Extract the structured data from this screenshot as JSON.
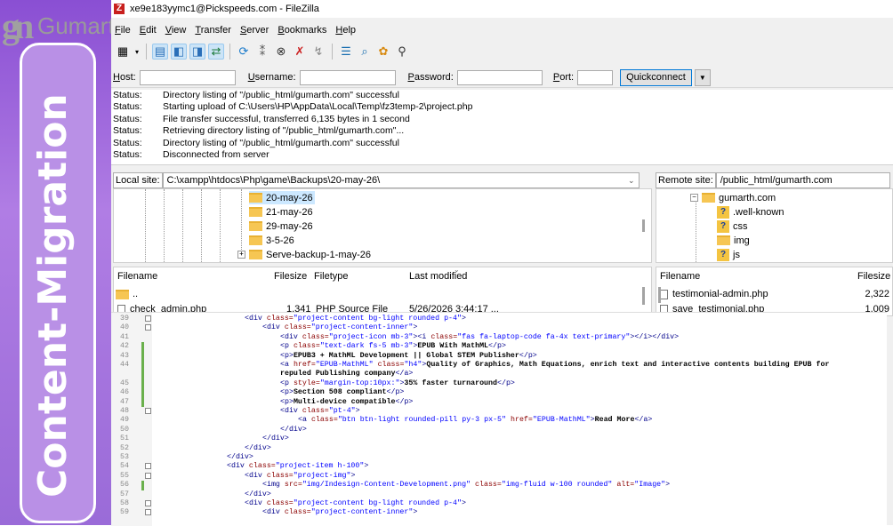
{
  "banner": {
    "logo_mark": "gn",
    "logo_text": "Gumarth",
    "vertical_text": "Content-Migration"
  },
  "window": {
    "title": "xe9e183yymc1@Pickspeeds.com - FileZilla",
    "app_icon": "Z"
  },
  "menu": [
    "File",
    "Edit",
    "View",
    "Transfer",
    "Server",
    "Bookmarks",
    "Help"
  ],
  "quickconnect": {
    "host_label": "Host:",
    "user_label": "Username:",
    "pass_label": "Password:",
    "port_label": "Port:",
    "button": "Quickconnect",
    "host": "",
    "username": "",
    "password": "",
    "port": ""
  },
  "log": [
    {
      "k": "Status:",
      "v": "Directory listing of \"/public_html/gumarth.com\" successful"
    },
    {
      "k": "Status:",
      "v": "Starting upload of C:\\Users\\HP\\AppData\\Local\\Temp\\fz3temp-2\\project.php"
    },
    {
      "k": "Status:",
      "v": "File transfer successful, transferred 6,135 bytes in 1 second"
    },
    {
      "k": "Status:",
      "v": "Retrieving directory listing of \"/public_html/gumarth.com\"..."
    },
    {
      "k": "Status:",
      "v": "Directory listing of \"/public_html/gumarth.com\" successful"
    },
    {
      "k": "Status:",
      "v": "Disconnected from server"
    }
  ],
  "local": {
    "site_label": "Local site:",
    "path": "C:\\xampp\\htdocs\\Php\\game\\Backups\\20-may-26\\",
    "tree": [
      "20-may-26",
      "21-may-26",
      "29-may-26",
      "3-5-26",
      "Serve-backup-1-may-26"
    ],
    "headers": {
      "name": "Filename",
      "size": "Filesize",
      "type": "Filetype",
      "modified": "Last modified"
    },
    "files": [
      {
        "name": "..",
        "size": "",
        "type": "",
        "modified": ""
      },
      {
        "name": "check_admin.php",
        "size": "1,341",
        "type": "PHP Source File",
        "modified": "5/26/2026 3:44:17 ..."
      }
    ]
  },
  "remote": {
    "site_label": "Remote site:",
    "path": "/public_html/gumarth.com",
    "tree": [
      {
        "name": "gumarth.com",
        "icon": "folder"
      },
      {
        "name": ".well-known",
        "icon": "question"
      },
      {
        "name": "css",
        "icon": "question"
      },
      {
        "name": "img",
        "icon": "folder"
      },
      {
        "name": "js",
        "icon": "question"
      }
    ],
    "headers": {
      "name": "Filename",
      "size": "Filesize"
    },
    "files": [
      {
        "name": "testimonial-admin.php",
        "size": "2,322"
      },
      {
        "name": "save_testimonial.php",
        "size": "1,009"
      }
    ]
  },
  "code": [
    {
      "n": "39",
      "ind": 20,
      "fold": true,
      "chg": false,
      "s": [
        [
          "t",
          "<div "
        ],
        [
          "a",
          "class="
        ],
        [
          "v",
          "\"project-content bg-light rounded p-4\""
        ],
        [
          "t",
          ">"
        ]
      ]
    },
    {
      "n": "40",
      "ind": 24,
      "fold": true,
      "chg": false,
      "s": [
        [
          "t",
          "<div "
        ],
        [
          "a",
          "class="
        ],
        [
          "v",
          "\"project-content-inner\""
        ],
        [
          "t",
          ">"
        ]
      ]
    },
    {
      "n": "41",
      "ind": 28,
      "fold": false,
      "chg": false,
      "s": [
        [
          "t",
          "<div "
        ],
        [
          "a",
          "class="
        ],
        [
          "v",
          "\"project-icon mb-3\""
        ],
        [
          "t",
          "><i "
        ],
        [
          "a",
          "class="
        ],
        [
          "v",
          "\"fas fa-laptop-code fa-4x text-primary\""
        ],
        [
          "t",
          "></i></div>"
        ]
      ]
    },
    {
      "n": "42",
      "ind": 28,
      "fold": false,
      "chg": true,
      "s": [
        [
          "t",
          "<p "
        ],
        [
          "a",
          "class="
        ],
        [
          "v",
          "\"text-dark fs-5 mb-3\""
        ],
        [
          "t",
          ">"
        ],
        [
          "c",
          "EPUB With MathML"
        ],
        [
          "t",
          "</p>"
        ]
      ]
    },
    {
      "n": "43",
      "ind": 28,
      "fold": false,
      "chg": true,
      "s": [
        [
          "t",
          "<p>"
        ],
        [
          "c",
          "EPUB3 + MathML Development || Global STEM Publisher"
        ],
        [
          "t",
          "</p>"
        ]
      ]
    },
    {
      "n": "44",
      "ind": 28,
      "fold": false,
      "chg": true,
      "s": [
        [
          "t",
          "<a "
        ],
        [
          "a",
          "href="
        ],
        [
          "v",
          "\"EPUB-MathML\""
        ],
        [
          "t",
          " "
        ],
        [
          "a",
          "class="
        ],
        [
          "v",
          "\"h4\""
        ],
        [
          "t",
          ">"
        ],
        [
          "c",
          "Quality of Graphics, Math Equations, enrich text and interactive contents building EPUB for"
        ]
      ]
    },
    {
      "n": "",
      "ind": 28,
      "fold": false,
      "chg": true,
      "s": [
        [
          "c",
          "repuled Publishing company"
        ],
        [
          "t",
          "</a>"
        ]
      ]
    },
    {
      "n": "45",
      "ind": 28,
      "fold": false,
      "chg": true,
      "s": [
        [
          "t",
          "<p "
        ],
        [
          "a",
          "style="
        ],
        [
          "v",
          "\"margin-top:10px:\""
        ],
        [
          "t",
          ">"
        ],
        [
          "c",
          "35% faster turnaround"
        ],
        [
          "t",
          "</p>"
        ]
      ]
    },
    {
      "n": "46",
      "ind": 28,
      "fold": false,
      "chg": true,
      "s": [
        [
          "t",
          "<p>"
        ],
        [
          "c",
          "Section 508 compliant"
        ],
        [
          "t",
          "</p>"
        ]
      ]
    },
    {
      "n": "47",
      "ind": 28,
      "fold": false,
      "chg": true,
      "s": [
        [
          "t",
          "<p>"
        ],
        [
          "c",
          "Multi-device compatible"
        ],
        [
          "t",
          "</p>"
        ]
      ]
    },
    {
      "n": "48",
      "ind": 28,
      "fold": true,
      "chg": false,
      "s": [
        [
          "t",
          "<div "
        ],
        [
          "a",
          "class="
        ],
        [
          "v",
          "\"pt-4\""
        ],
        [
          "t",
          ">"
        ]
      ]
    },
    {
      "n": "49",
      "ind": 32,
      "fold": false,
      "chg": false,
      "s": [
        [
          "t",
          "<a "
        ],
        [
          "a",
          "class="
        ],
        [
          "v",
          "\"btn btn-light rounded-pill py-3 px-5\""
        ],
        [
          "t",
          " "
        ],
        [
          "a",
          "href="
        ],
        [
          "v",
          "\"EPUB-MathML\""
        ],
        [
          "t",
          ">"
        ],
        [
          "c",
          "Read More"
        ],
        [
          "t",
          "</a>"
        ]
      ]
    },
    {
      "n": "50",
      "ind": 28,
      "fold": false,
      "chg": false,
      "s": [
        [
          "t",
          "</div>"
        ]
      ]
    },
    {
      "n": "51",
      "ind": 24,
      "fold": false,
      "chg": false,
      "s": [
        [
          "t",
          "</div>"
        ]
      ]
    },
    {
      "n": "52",
      "ind": 20,
      "fold": false,
      "chg": false,
      "s": [
        [
          "t",
          "</div>"
        ]
      ]
    },
    {
      "n": "53",
      "ind": 16,
      "fold": false,
      "chg": false,
      "s": [
        [
          "t",
          "</div>"
        ]
      ]
    },
    {
      "n": "54",
      "ind": 16,
      "fold": true,
      "chg": false,
      "s": [
        [
          "t",
          "<div "
        ],
        [
          "a",
          "class="
        ],
        [
          "v",
          "\"project-item h-100\""
        ],
        [
          "t",
          ">"
        ]
      ]
    },
    {
      "n": "55",
      "ind": 20,
      "fold": true,
      "chg": false,
      "s": [
        [
          "t",
          "<div "
        ],
        [
          "a",
          "class="
        ],
        [
          "v",
          "\"project-img\""
        ],
        [
          "t",
          ">"
        ]
      ]
    },
    {
      "n": "56",
      "ind": 24,
      "fold": false,
      "chg": true,
      "s": [
        [
          "t",
          "<img "
        ],
        [
          "a",
          "src="
        ],
        [
          "v",
          "\"img/Indesign-Content-Development.png\""
        ],
        [
          "t",
          " "
        ],
        [
          "a",
          "class="
        ],
        [
          "v",
          "\"img-fluid w-100 rounded\""
        ],
        [
          "t",
          " "
        ],
        [
          "a",
          "alt="
        ],
        [
          "v",
          "\"Image\""
        ],
        [
          "t",
          ">"
        ]
      ]
    },
    {
      "n": "57",
      "ind": 20,
      "fold": false,
      "chg": false,
      "s": [
        [
          "t",
          "</div>"
        ]
      ]
    },
    {
      "n": "58",
      "ind": 20,
      "fold": true,
      "chg": false,
      "s": [
        [
          "t",
          "<div "
        ],
        [
          "a",
          "class="
        ],
        [
          "v",
          "\"project-content bg-light rounded p-4\""
        ],
        [
          "t",
          ">"
        ]
      ]
    },
    {
      "n": "59",
      "ind": 24,
      "fold": true,
      "chg": false,
      "s": [
        [
          "t",
          "<div "
        ],
        [
          "a",
          "class="
        ],
        [
          "v",
          "\"project-content-inner\""
        ],
        [
          "t",
          ">"
        ]
      ]
    }
  ]
}
